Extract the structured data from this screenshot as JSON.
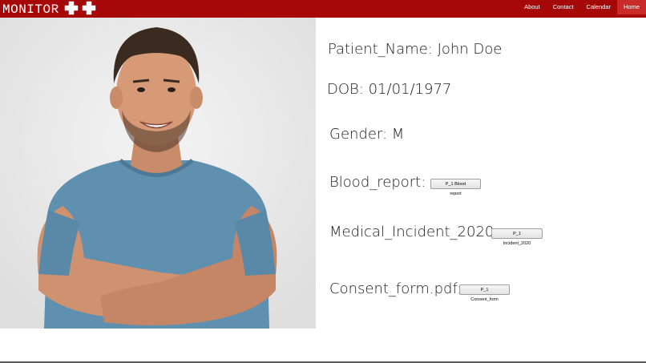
{
  "header": {
    "brand": "MONITOR",
    "bg_color": "#a60707",
    "icons": [
      "medical-cross-icon",
      "medical-cross-icon"
    ],
    "nav": [
      {
        "label": "About",
        "active": false
      },
      {
        "label": "Contact",
        "active": false
      },
      {
        "label": "Calendar",
        "active": false
      },
      {
        "label": "Home",
        "active": true
      }
    ]
  },
  "patient": {
    "name_label": "Patient_Name: John Doe",
    "dob_label": "DOB: 01/01/1977",
    "gender_label": "Gender: M",
    "blood_label": "Blood_report:",
    "blood_button": "P_1 Blood report",
    "incident_label": "Medical_Incident_2020:",
    "incident_button": "P_1 Incident_2020",
    "consent_label": "Consent_form.pdf:",
    "consent_button": "P_1 Consent_form"
  }
}
